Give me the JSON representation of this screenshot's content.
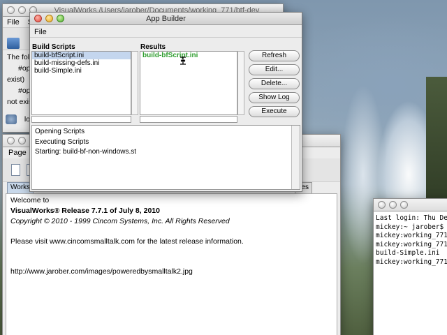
{
  "colors": {
    "selection": "#c4d6ee",
    "result_text": "#2e9d2e"
  },
  "visualworks": {
    "title": "VisualWorks /Users/jarober/Documents/working_771/btf-dev",
    "menu": [
      "File",
      "S"
    ],
    "text_lines": [
      "The foll",
      "#op",
      "exist)",
      "#op",
      "not exis"
    ],
    "status": "loo"
  },
  "workspace": {
    "menu": [
      "Page"
    ],
    "tab": "Works",
    "tab2": "iles",
    "lines": {
      "welcome": "Welcome to",
      "release": "VisualWorks® Release  7.7.1 of July 8, 2010",
      "copyright": "Copyright © 2010 - 1999 Cincom Systems, Inc.  All Rights Reserved",
      "visit": "Please visit www.cincomsmalltalk.com for the latest release information.",
      "url": "http://www.jarober.com/images/poweredbysmalltalk2.jpg"
    }
  },
  "terminal": {
    "lines": [
      "Last login: Thu Dec",
      "mickey:~ jarober$ c",
      "mickey:working_771",
      "mickey:working_771",
      "build-Simple.ini",
      "mickey:working_771"
    ]
  },
  "app_builder": {
    "title": "App Builder",
    "menu_file": "File",
    "build_scripts_label": "Build Scripts",
    "results_label": "Results",
    "scripts": [
      "build-bfScript.ini",
      "build-missing-defs.ini",
      "build-Simple.ini"
    ],
    "results": [
      "build-bfScript.ini"
    ],
    "buttons": {
      "refresh": "Refresh",
      "edit": "Edit...",
      "delete": "Delete...",
      "show_log": "Show Log",
      "execute": "Execute"
    },
    "log_lines": [
      "Opening Scripts",
      "Executing Scripts",
      "Starting: build-bf-non-windows.st"
    ]
  }
}
